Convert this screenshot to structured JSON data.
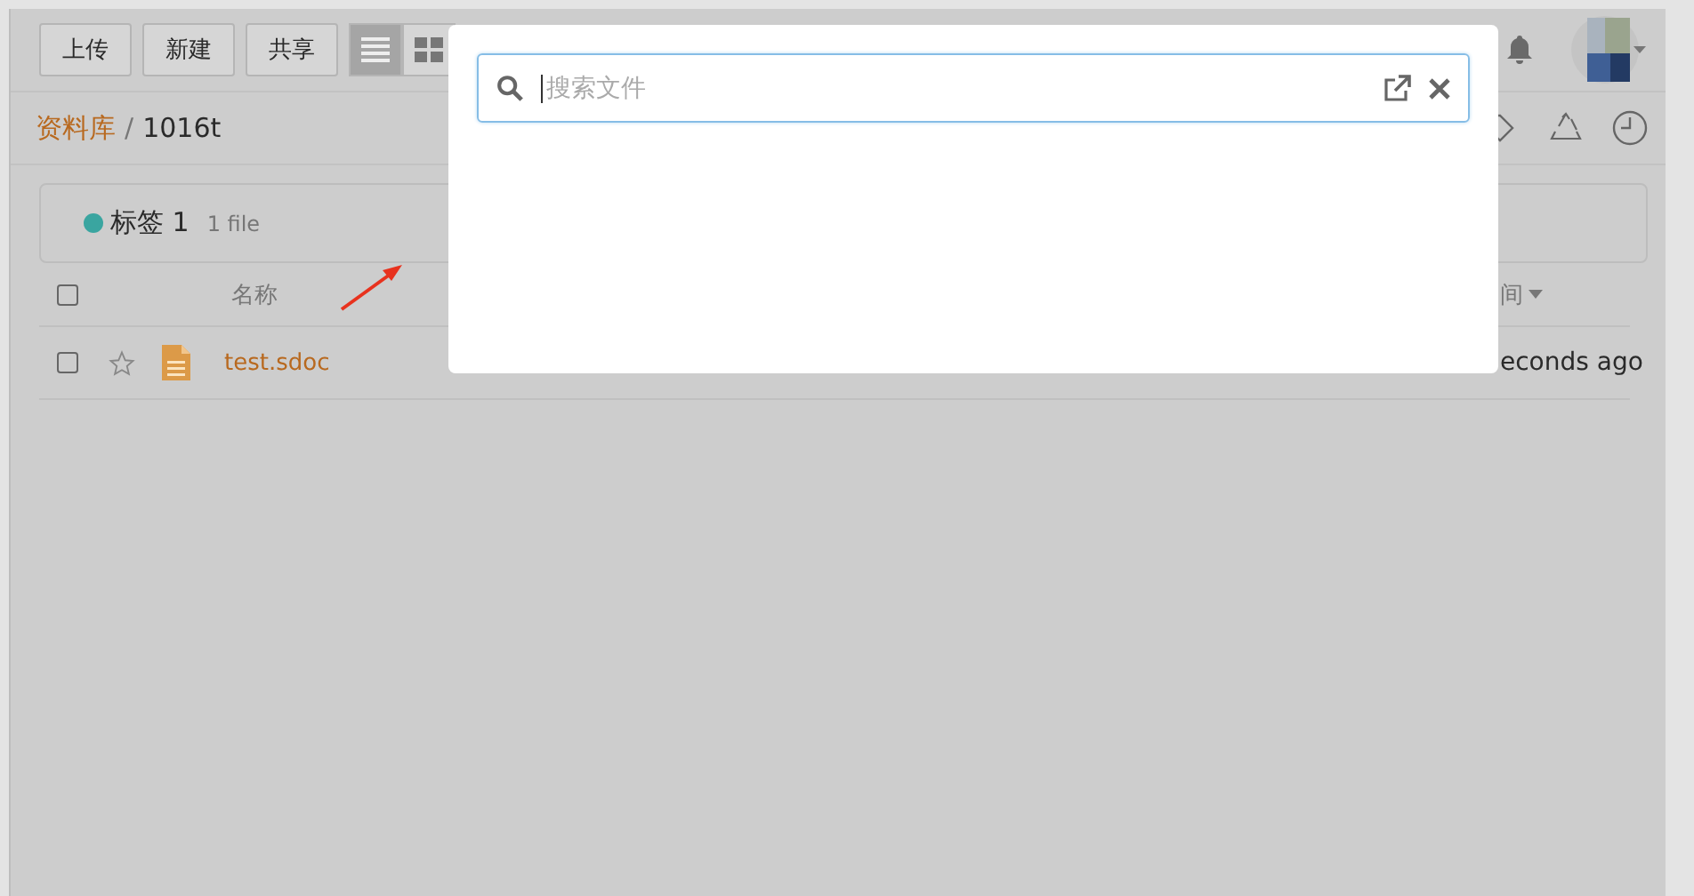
{
  "toolbar": {
    "buttons": [
      {
        "label": "上传"
      },
      {
        "label": "新建"
      },
      {
        "label": "共享"
      }
    ],
    "views": [
      {
        "kind": "list",
        "selected": true
      },
      {
        "kind": "grid",
        "selected": false
      }
    ]
  },
  "breadcrumb": {
    "root": "资料库",
    "separator": "/",
    "current": "1016t"
  },
  "tag": {
    "name": "标签 1",
    "count": "1 file",
    "color": "#3aa5a0"
  },
  "table": {
    "select_all_checked": false,
    "columns": [
      "名称",
      "间"
    ],
    "rows": [
      {
        "name": "test.sdoc",
        "starred": false,
        "checked": false,
        "modified": "econds ago"
      }
    ]
  },
  "search_dialog": {
    "placeholder": "搜索文件"
  }
}
